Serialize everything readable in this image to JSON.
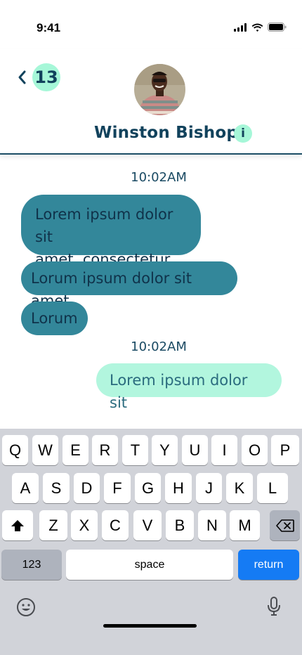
{
  "status_bar": {
    "time": "9:41"
  },
  "header": {
    "back_count": "13",
    "contact_name": "Winston Bishop",
    "info_label": "i"
  },
  "chat": {
    "timestamps": [
      "10:02AM",
      "10:02AM"
    ],
    "incoming": [
      {
        "line1": "Lorem ipsum dolor sit",
        "line2": "amet, consectetur"
      },
      {
        "text": "Lorum ipsum dolor sit amet"
      },
      {
        "text": "Lorum"
      }
    ],
    "outgoing": [
      {
        "text": "Lorem ipsum dolor sit"
      }
    ]
  },
  "keyboard": {
    "row1": [
      "Q",
      "W",
      "E",
      "R",
      "T",
      "Y",
      "U",
      "I",
      "O",
      "P"
    ],
    "row2": [
      "A",
      "S",
      "D",
      "F",
      "G",
      "H",
      "J",
      "K",
      "L"
    ],
    "row3": [
      "Z",
      "X",
      "C",
      "V",
      "B",
      "N",
      "M"
    ],
    "numbers_label": "123",
    "space_label": "space",
    "return_label": "return"
  },
  "colors": {
    "accent": "#a6f7d8",
    "incoming_bubble": "#33879a",
    "outgoing_bubble": "#b2f6de",
    "return_key": "#157bf4"
  }
}
